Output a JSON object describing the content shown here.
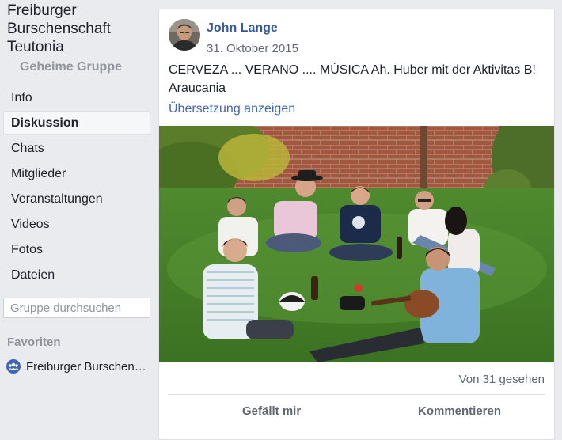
{
  "group": {
    "name": "Freiburger Burschenschaft Teutonia",
    "privacy": "Geheime Gruppe"
  },
  "nav": {
    "items": [
      {
        "label": "Info"
      },
      {
        "label": "Diskussion"
      },
      {
        "label": "Chats"
      },
      {
        "label": "Mitglieder"
      },
      {
        "label": "Veranstaltungen"
      },
      {
        "label": "Videos"
      },
      {
        "label": "Fotos"
      },
      {
        "label": "Dateien"
      }
    ],
    "active": "Diskussion"
  },
  "search": {
    "placeholder": "Gruppe durchsuchen"
  },
  "favorites": {
    "heading": "Favoriten",
    "items": [
      {
        "label": "Freiburger Burschenschaft Teutonia",
        "icon": "group-icon"
      }
    ]
  },
  "post": {
    "author": "John Lange",
    "date": "31. Oktober 2015",
    "text": "CERVEZA ... VERANO .... MÚSICA Ah. Huber mit der Aktivitas B! Araucania",
    "translate_label": "Übersetzung anzeigen",
    "seen": "Von 31 gesehen",
    "like_label": "Gefällt mir",
    "comment_label": "Kommentieren"
  },
  "colors": {
    "background": "#e9ebee",
    "link": "#365899",
    "accent": "#4267b2"
  }
}
